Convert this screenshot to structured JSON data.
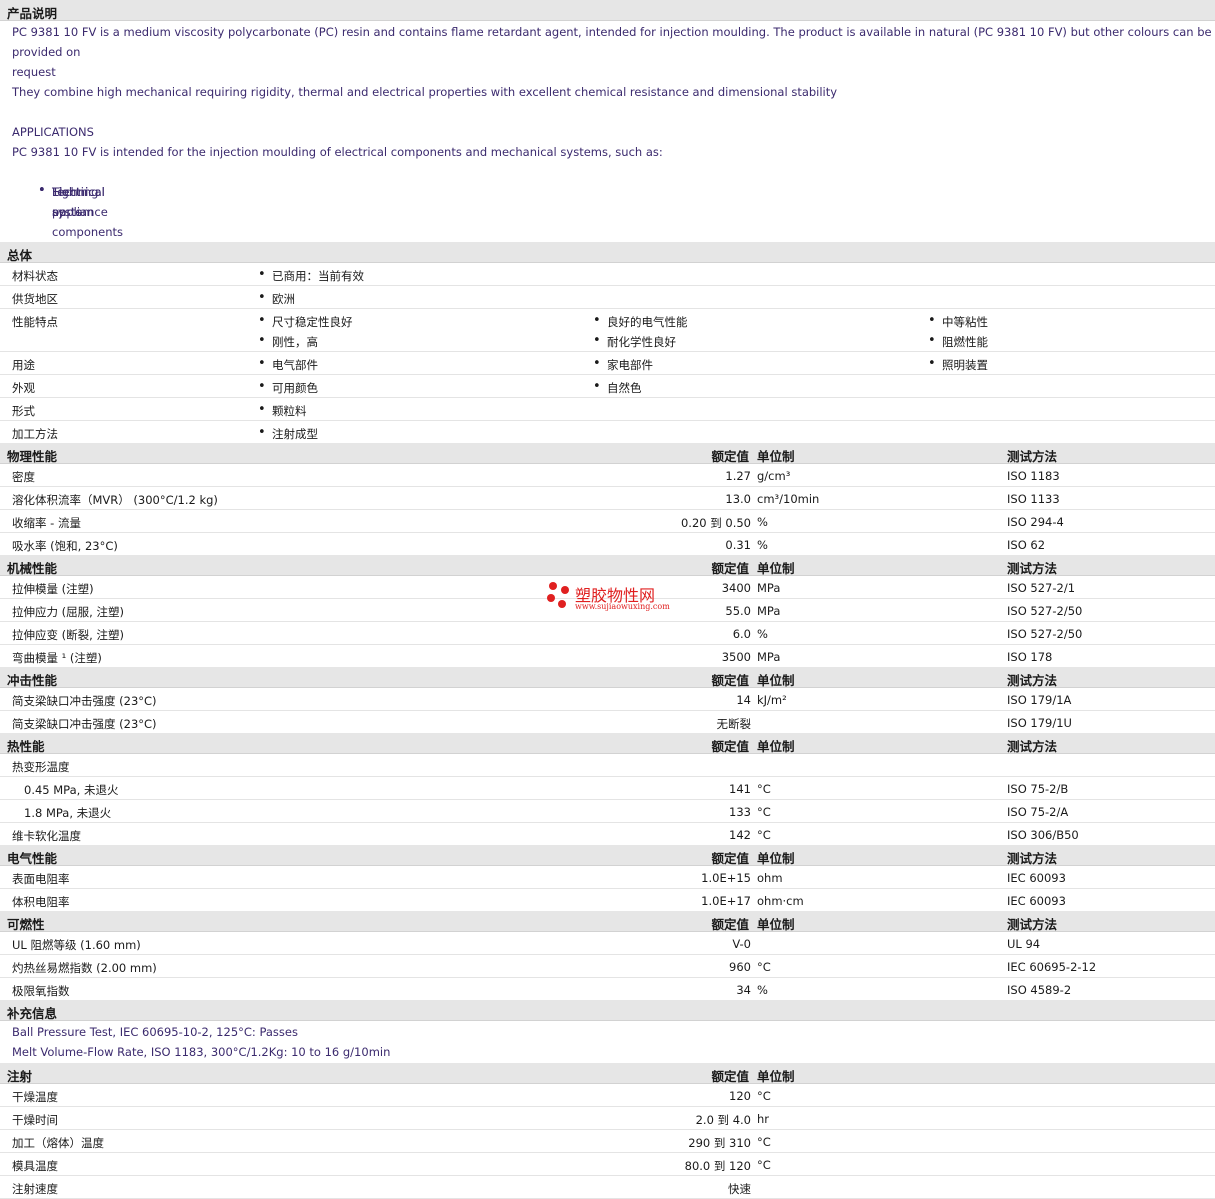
{
  "description": {
    "header": "产品说明",
    "p1": "PC 9381 10 FV is a medium viscosity polycarbonate (PC) resin and contains flame retardant agent, intended for injection moulding. The product is available in natural (PC 9381 10 FV) but other colours can be provided on",
    "p1b": "request",
    "p2": "They combine high mechanical requiring rigidity, thermal and electrical properties with excellent chemical resistance and dimensional stability",
    "applications": "APPLICATIONS",
    "p3": "PC 9381 10 FV is intended for the injection moulding of electrical components and mechanical systems, such as:",
    "bullets": [
      "Electrical appliance components",
      "Lighting system",
      "Technical parts"
    ]
  },
  "general": {
    "header": "总体",
    "rows": [
      {
        "label": "材料状态",
        "items": [
          "已商用：当前有效"
        ]
      },
      {
        "label": "供货地区",
        "items": [
          "欧洲"
        ]
      },
      {
        "label": "性能特点",
        "items": [
          "尺寸稳定性良好",
          "良好的电气性能",
          "中等粘性",
          "刚性，高",
          "耐化学性良好",
          "阻燃性能"
        ]
      },
      {
        "label": "用途",
        "items": [
          "电气部件",
          "家电部件",
          "照明装置"
        ]
      },
      {
        "label": "外观",
        "items": [
          "可用颜色",
          "自然色"
        ]
      },
      {
        "label": "形式",
        "items": [
          "颗粒料"
        ]
      },
      {
        "label": "加工方法",
        "items": [
          "注射成型"
        ]
      }
    ]
  },
  "col_headers": {
    "value": "额定值",
    "unit": "单位制",
    "method": "测试方法"
  },
  "physical": {
    "header": "物理性能",
    "rows": [
      {
        "label": "密度",
        "value": "1.27",
        "unit": "g/cm³",
        "method": "ISO 1183"
      },
      {
        "label": "溶化体积流率（MVR） (300°C/1.2 kg)",
        "value": "13.0",
        "unit": "cm³/10min",
        "method": "ISO 1133"
      },
      {
        "label": "收缩率 - 流量",
        "value": "0.20 到  0.50",
        "unit": "%",
        "method": "ISO 294-4"
      },
      {
        "label": "吸水率 (饱和, 23°C)",
        "value": "0.31",
        "unit": "%",
        "method": "ISO 62"
      }
    ]
  },
  "mechanical": {
    "header": "机械性能",
    "rows": [
      {
        "label": "拉伸模量 (注塑)",
        "value": "3400",
        "unit": "MPa",
        "method": "ISO 527-2/1"
      },
      {
        "label": "拉伸应力 (屈服, 注塑)",
        "value": "55.0",
        "unit": "MPa",
        "method": "ISO 527-2/50"
      },
      {
        "label": "拉伸应变 (断裂, 注塑)",
        "value": "6.0",
        "unit": "%",
        "method": "ISO 527-2/50"
      },
      {
        "label": "弯曲模量 ¹ (注塑)",
        "value": "3500",
        "unit": "MPa",
        "method": "ISO 178"
      }
    ]
  },
  "impact": {
    "header": "冲击性能",
    "rows": [
      {
        "label": "简支梁缺口冲击强度 (23°C)",
        "value": "14",
        "unit": "kJ/m²",
        "method": "ISO 179/1A"
      },
      {
        "label": "简支梁缺口冲击强度 (23°C)",
        "value": "无断裂",
        "unit": "",
        "method": "ISO 179/1U"
      }
    ]
  },
  "thermal": {
    "header": "热性能",
    "rows": [
      {
        "label": "热变形温度",
        "value": "",
        "unit": "",
        "method": ""
      },
      {
        "label": "0.45 MPa, 未退火",
        "value": "141",
        "unit": "°C",
        "method": "ISO 75-2/B"
      },
      {
        "label": "1.8 MPa, 未退火",
        "value": "133",
        "unit": "°C",
        "method": "ISO 75-2/A"
      },
      {
        "label": "维卡软化温度",
        "value": "142",
        "unit": "°C",
        "method": "ISO 306/B50"
      }
    ]
  },
  "electrical": {
    "header": "电气性能",
    "rows": [
      {
        "label": "表面电阻率",
        "value": "1.0E+15",
        "unit": "ohm",
        "method": "IEC 60093"
      },
      {
        "label": "体积电阻率",
        "value": "1.0E+17",
        "unit": "ohm·cm",
        "method": "IEC 60093"
      }
    ]
  },
  "flammability": {
    "header": "可燃性",
    "rows": [
      {
        "label": "UL 阻燃等级 (1.60 mm)",
        "value": "V-0",
        "unit": "",
        "method": "UL 94"
      },
      {
        "label": "灼热丝易燃指数 (2.00 mm)",
        "value": "960",
        "unit": "°C",
        "method": "IEC 60695-2-12"
      },
      {
        "label": "极限氧指数",
        "value": "34",
        "unit": "%",
        "method": "ISO 4589-2"
      }
    ]
  },
  "supplement": {
    "header": "补充信息",
    "lines": [
      "Ball Pressure Test, IEC 60695-10-2, 125°C: Passes",
      "Melt Volume-Flow Rate, ISO 1183, 300°C/1.2Kg: 10 to 16 g/10min"
    ]
  },
  "injection": {
    "header": "注射",
    "rows": [
      {
        "label": "干燥温度",
        "value": "120",
        "unit": "°C",
        "method": ""
      },
      {
        "label": "干燥时间",
        "value": "2.0 到  4.0",
        "unit": "hr",
        "method": ""
      },
      {
        "label": "加工（熔体）温度",
        "value": "290 到  310",
        "unit": "°C",
        "method": ""
      },
      {
        "label": "模具温度",
        "value": "80.0 到  120",
        "unit": "°C",
        "method": ""
      },
      {
        "label": "注射速度",
        "value": "快速",
        "unit": "",
        "method": ""
      }
    ]
  },
  "watermark": {
    "name": "塑胶物性网",
    "url": "www.sujiaowuxing.com"
  }
}
